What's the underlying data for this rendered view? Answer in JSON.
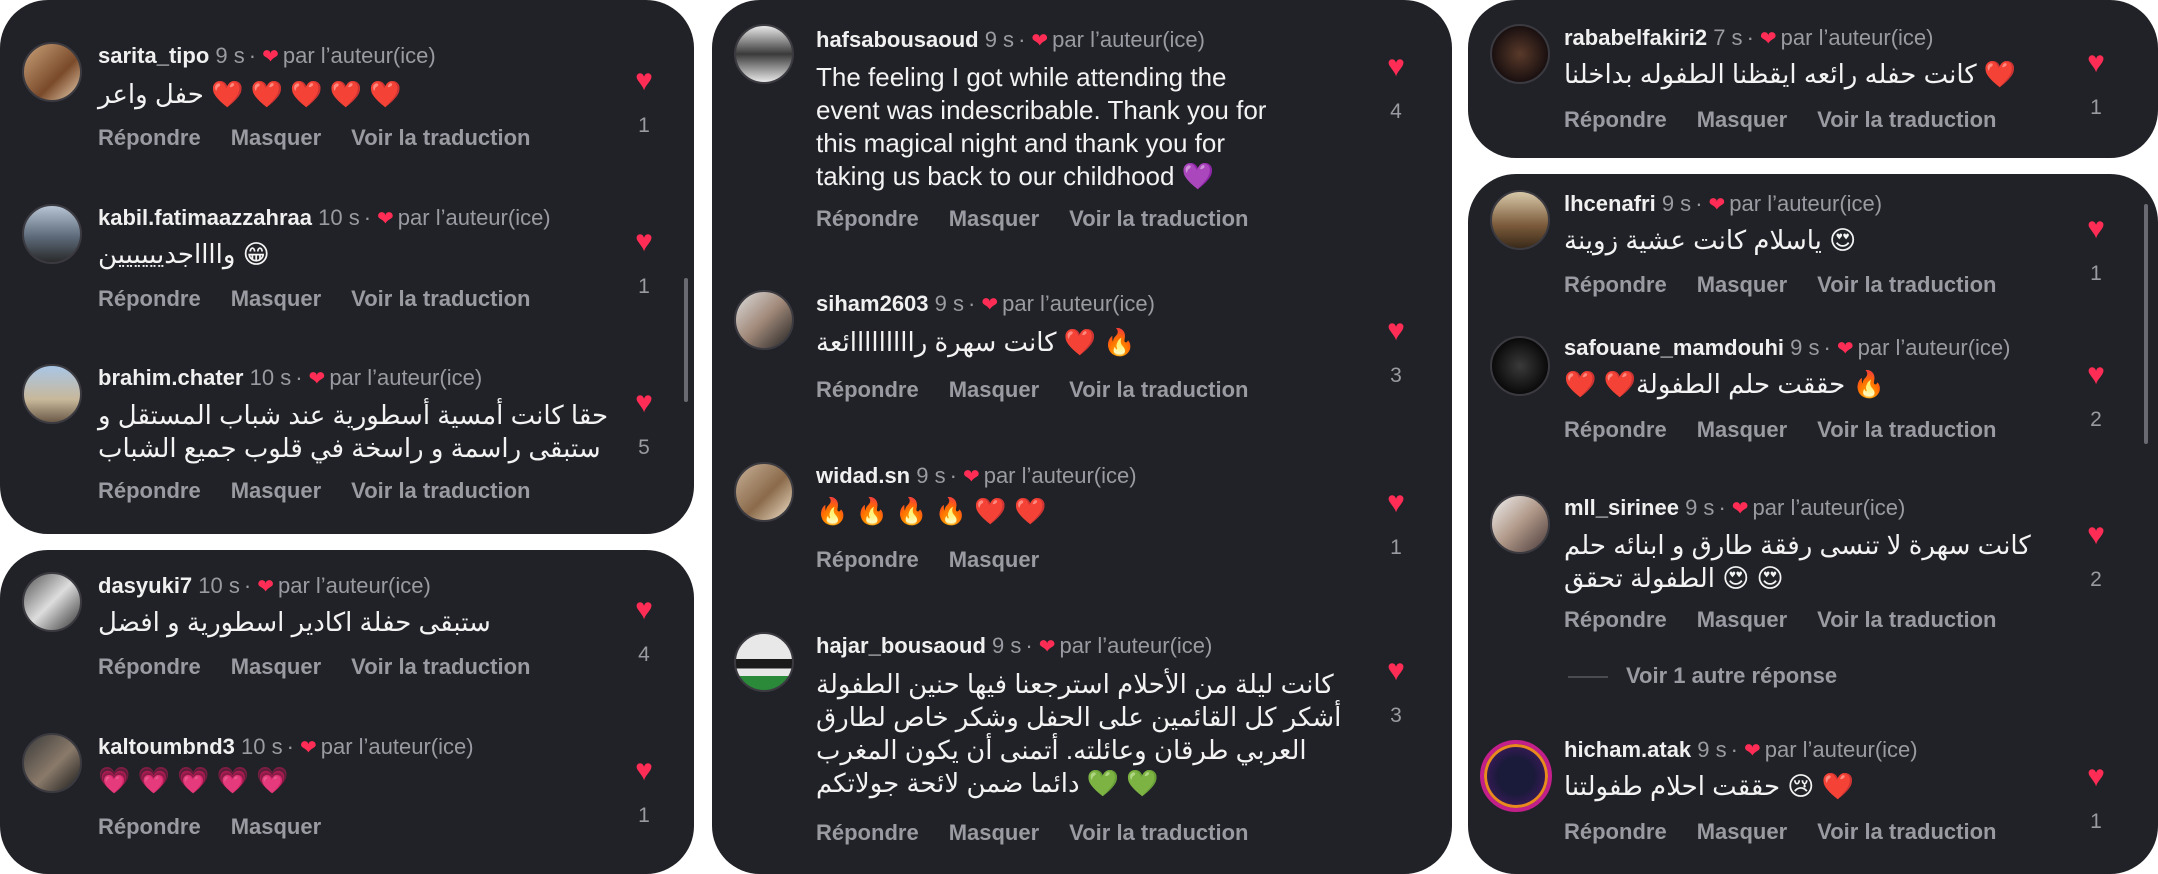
{
  "labels": {
    "reply": "Répondre",
    "hide": "Masquer",
    "translate": "Voir la traduction",
    "by_author": "par l’auteur(ice)",
    "more_replies": "Voir 1 autre réponse"
  },
  "colors": {
    "panel_bg": "#212227",
    "heart": "#ff2d55",
    "muted": "#9a9ba2"
  },
  "panel1": [
    {
      "user": "sarita_tipo",
      "time": "9 s",
      "text": "❤️ ❤️ ❤️ ❤️ ❤️ حفل واعر",
      "likes": "1"
    },
    {
      "user": "kabil.fatimaazzahraa",
      "time": "10 s",
      "text": "😁 وااااجديييييين",
      "likes": "1"
    },
    {
      "user": "brahim.chater",
      "time": "10 s",
      "text": "حقا كانت أمسية أسطورية عند شباب المستقل و\nستبقى راسمة و راسخة في قلوب جميع الشباب",
      "likes": "5"
    }
  ],
  "panel2": [
    {
      "user": "dasyuki7",
      "time": "10 s",
      "text": "ستبقى حفلة اكادير اسطورية و افضل",
      "likes": "4"
    },
    {
      "user": "kaltoumbnd3",
      "time": "10 s",
      "text": "💗 💗 💗 💗 💗",
      "likes": "1"
    }
  ],
  "panel3": [
    {
      "user": "hafsabousaoud",
      "time": "9 s",
      "text": "The feeling I got while attending the\nevent was indescribable. Thank you for\nthis magical night and thank you for\ntaking us back to our childhood 💜",
      "likes": "4"
    },
    {
      "user": "siham2603",
      "time": "9 s",
      "text": "🔥 ❤️ كانت سهرة رااااااااائعة",
      "likes": "3"
    },
    {
      "user": "widad.sn",
      "time": "9 s",
      "text": "🔥 🔥 🔥 🔥 ❤️ ❤️",
      "likes": "1"
    },
    {
      "user": "hajar_bousaoud",
      "time": "9 s",
      "text": "كانت ليلة من الأحلام استرجعنا فيها حنين الطفولة\nأشكر كل القائمين على الحفل وشكر خاص لطارق\nالعربي طرقان وعائلته. أتمنى أن يكون المغرب\n💚 💚 دائما ضمن لائحة جولاتكم",
      "likes": "3"
    }
  ],
  "panel4": [
    {
      "user": "rababelfakiri2",
      "time": "7 s",
      "text": "❤️ كانت حفله رائعه ايقظنا الطفوله بداخلنا",
      "likes": "1"
    }
  ],
  "panel5": [
    {
      "user": "lhcenafri",
      "time": "9 s",
      "text": "😍 ياسلام كانت عشية زوينة",
      "likes": "1"
    },
    {
      "user": "safouane_mamdouhi",
      "time": "9 s",
      "text": "🔥 حققت حلم الطفولة❤️ ❤️",
      "likes": "2"
    },
    {
      "user": "mll_sirinee",
      "time": "9 s",
      "text": "كانت سهرة لا تنسى رفقة طارق و ابنائه حلم\n😍 😍 الطفولة تحقق",
      "likes": "2"
    },
    {
      "user": "hicham.atak",
      "time": "9 s",
      "text": "❤️ 😢 حققت احلام طفولتنا",
      "likes": "1"
    }
  ]
}
